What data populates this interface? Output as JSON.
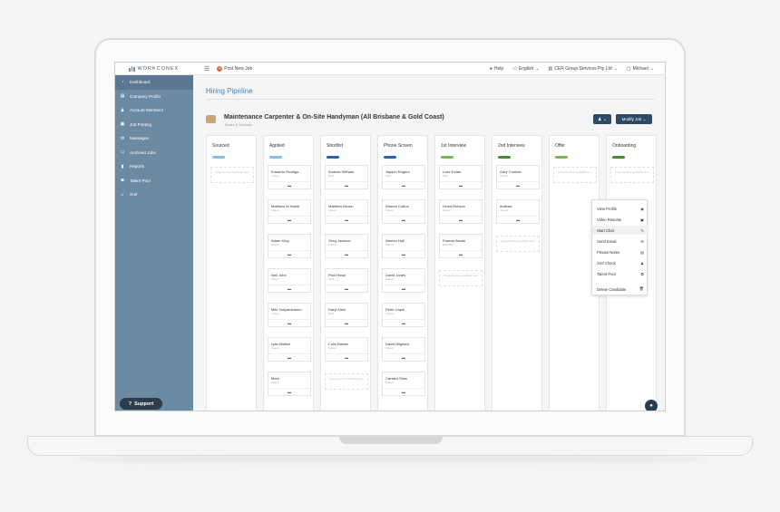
{
  "topbar": {
    "logo_text": "WORKCONEX",
    "post_job": "Post New Job",
    "help": "Help",
    "language": "English",
    "company": "CER Group Services Pty Ltd",
    "user": "Michael"
  },
  "sidebar": {
    "items": [
      {
        "label": "Dashboard",
        "icon": "dashboard-icon"
      },
      {
        "label": "Company Profile",
        "icon": "company-icon"
      },
      {
        "label": "Account Members",
        "icon": "members-icon"
      },
      {
        "label": "Job Posting",
        "icon": "briefcase-icon"
      },
      {
        "label": "Messages",
        "icon": "envelope-icon"
      },
      {
        "label": "Archived Jobs",
        "icon": "archive-icon"
      },
      {
        "label": "Reports",
        "icon": "chart-icon"
      },
      {
        "label": "Talent Pool",
        "icon": "talent-icon"
      },
      {
        "label": "Xref",
        "icon": "home-icon"
      }
    ],
    "support_label": "Support"
  },
  "main": {
    "page_title": "Hiring Pipeline",
    "job_title": "Maintenance Carpenter & On-Site Handyman (All Brisbane & Gold Coast)",
    "job_subtitle": "Trades & Services",
    "modify_job": "Modify Job"
  },
  "columns": [
    {
      "title": "Sourced",
      "color": "#8bbde6",
      "drop": "Drag and drop candidate here"
    },
    {
      "title": "Applied",
      "color": "#8bbde6",
      "cards": [
        {
          "name": "Eduardo Rodrigu...",
          "src": "Indeed"
        },
        {
          "name": "Matthew M Habib",
          "src": "Indeed"
        },
        {
          "name": "Adam King",
          "src": "Indeed"
        },
        {
          "name": "Neil John",
          "src": "Indeed"
        },
        {
          "name": "Miki Yariyambamm",
          "src": "Indeed"
        },
        {
          "name": "ryan hilditch",
          "src": "Indeed"
        },
        {
          "name": "Mark",
          "src": "Indeed"
        }
      ]
    },
    {
      "title": "Shortlist",
      "color": "#2e5fa8",
      "cards": [
        {
          "name": "Andrew Witham",
          "src": "Seek"
        },
        {
          "name": "Matthew Brown",
          "src": "Indeed"
        },
        {
          "name": "Greg Jackson",
          "src": "Indeed"
        },
        {
          "name": "Paul Howe",
          "src": "Seek"
        },
        {
          "name": "Daryl Klein",
          "src": "Seek"
        },
        {
          "name": "Colin Barker",
          "src": "Indeed"
        }
      ],
      "drop": "Drag and drop candidate here"
    },
    {
      "title": "Phone Screen",
      "color": "#2e5fa8",
      "cards": [
        {
          "name": "Jayson Rogers",
          "src": "Seek"
        },
        {
          "name": "Warren Cotton",
          "src": "Indeed"
        },
        {
          "name": "Warren Hall",
          "src": "Indeed"
        },
        {
          "name": "David Jones",
          "src": "Indeed"
        },
        {
          "name": "Peter Capel",
          "src": "Indeed"
        },
        {
          "name": "David Blignaut",
          "src": "Indeed"
        },
        {
          "name": "Carsten Sims",
          "src": "Indeed"
        }
      ]
    },
    {
      "title": "1st Interview",
      "color": "#7cb35a",
      "cards": [
        {
          "name": "Luke Dolan",
          "src": "Seek"
        },
        {
          "name": "Grant Robson",
          "src": "Indeed"
        },
        {
          "name": "Francis Alcala",
          "src": "Referrals"
        }
      ],
      "drop": "Drag and drop candidate here"
    },
    {
      "title": "2nd Interview",
      "color": "#4e8a35",
      "cards": [
        {
          "name": "Gary Cumber",
          "src": "Indeed"
        },
        {
          "name": "Andrew",
          "src": "Indeed"
        }
      ],
      "drop": "Drag and drop candidate here"
    },
    {
      "title": "Offer",
      "color": "#7cb35a",
      "drop": "Drag and drop candidate here"
    },
    {
      "title": "Onboarding",
      "color": "#4e8a35",
      "drop": "Drag and drop candidate here"
    }
  ],
  "context_menu": {
    "items": [
      {
        "label": "View Profile",
        "icon": "eye-icon",
        "glyph": "◉"
      },
      {
        "label": "Video Resume",
        "icon": "video-icon",
        "glyph": "▣"
      },
      {
        "label": "Start Chat",
        "icon": "chat-icon",
        "glyph": "✎"
      },
      {
        "label": "Send Email",
        "icon": "email-icon",
        "glyph": "✉"
      },
      {
        "label": "Private Notes",
        "icon": "notes-icon",
        "glyph": "▤"
      },
      {
        "label": "Xref Check",
        "icon": "person-icon",
        "glyph": "♟"
      },
      {
        "label": "Talent Pool",
        "icon": "pool-icon",
        "glyph": "✪"
      },
      {
        "label": "Delete Candidate",
        "icon": "trash-icon",
        "glyph": "🗑"
      }
    ]
  }
}
